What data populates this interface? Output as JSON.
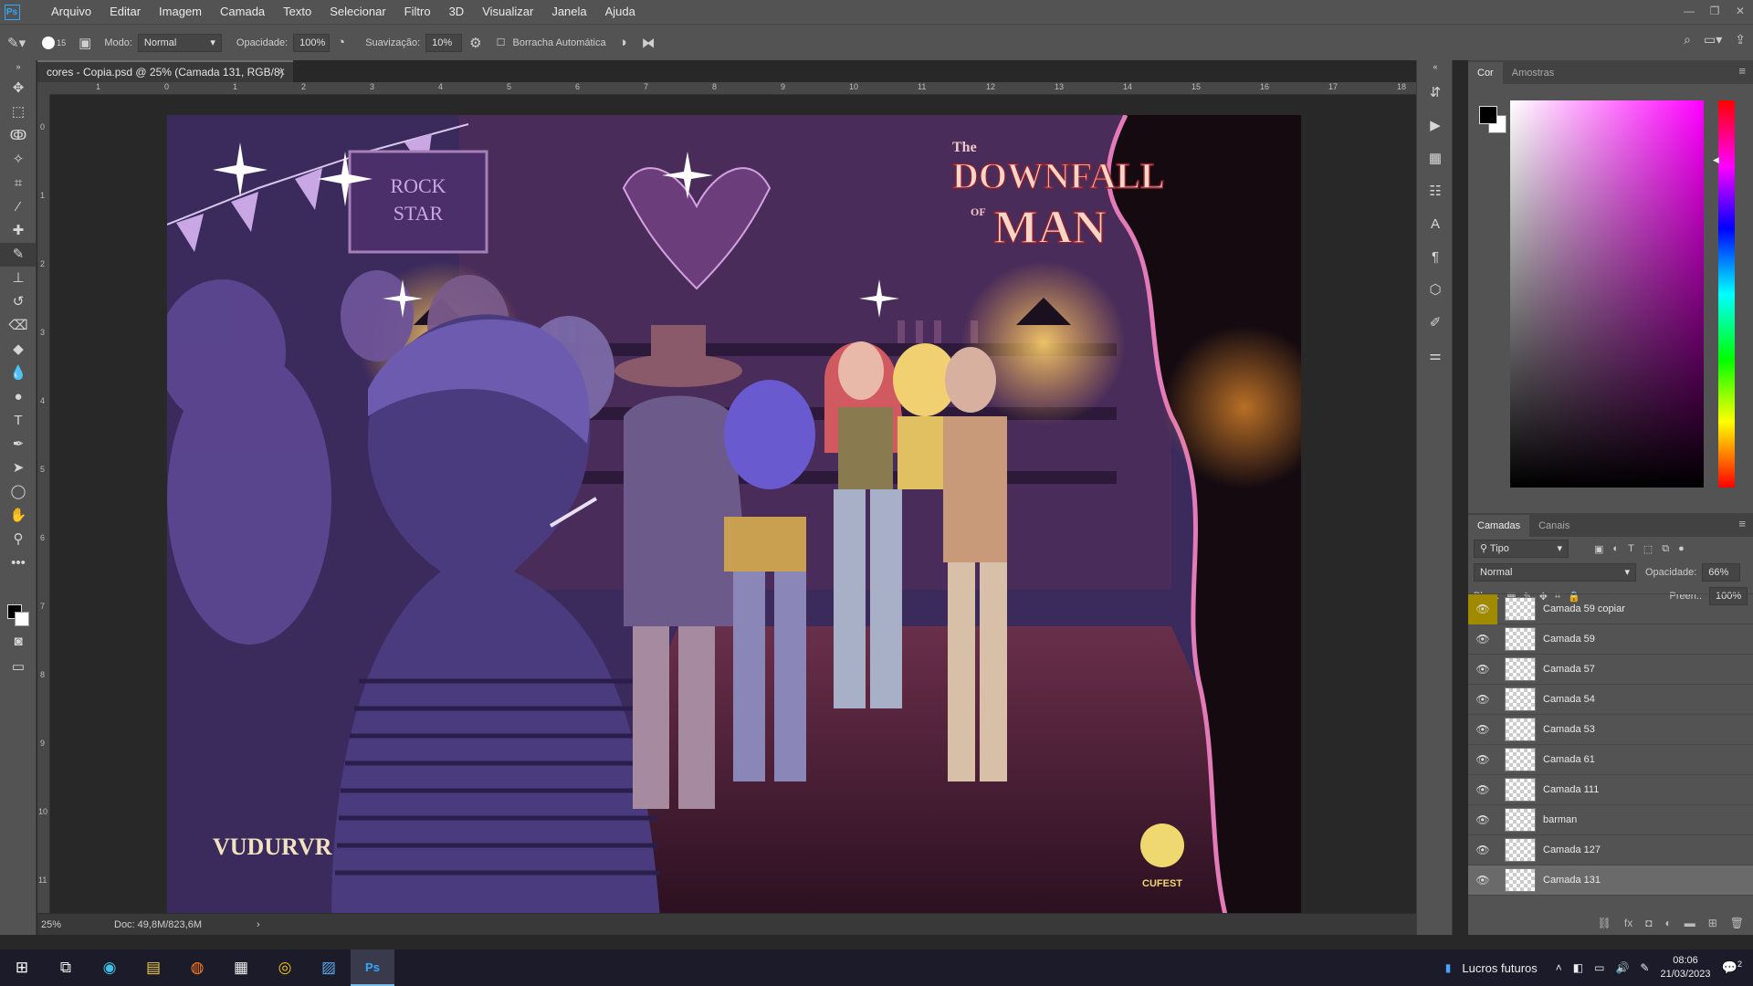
{
  "app": {
    "logo": "Ps"
  },
  "menu": [
    "Arquivo",
    "Editar",
    "Imagem",
    "Camada",
    "Texto",
    "Selecionar",
    "Filtro",
    "3D",
    "Visualizar",
    "Janela",
    "Ajuda"
  ],
  "options": {
    "brush_size": "15",
    "mode_label": "Modo:",
    "mode_value": "Normal",
    "opacity_label": "Opacidade:",
    "opacity_value": "100%",
    "smoothing_label": "Suavização:",
    "smoothing_value": "10%",
    "auto_erase_label": "Borracha Automática"
  },
  "document": {
    "tab_title": "cores - Copia.psd @ 25% (Camada 131, RGB/8)",
    "zoom": "25%",
    "doc_info": "Doc: 49,8M/823,6M",
    "ruler_h": [
      "1",
      "0",
      "1",
      "2",
      "3",
      "4",
      "5",
      "6",
      "7",
      "8",
      "9",
      "10",
      "11",
      "12",
      "13",
      "14",
      "15",
      "16",
      "17",
      "18"
    ],
    "ruler_v": [
      "0",
      "1",
      "2",
      "3",
      "4",
      "5",
      "6",
      "7",
      "8",
      "9",
      "10",
      "11"
    ]
  },
  "artwork": {
    "title_top": "The",
    "title_main": "DOWNFALL",
    "title_of": "OF",
    "title_end": "MAN",
    "signature_left": "VUDURVR",
    "signature_right": "CUFEST",
    "bar_sign_1": "ROCK",
    "bar_sign_2": "STAR"
  },
  "color_panel": {
    "tabs": [
      "Cor",
      "Amostras"
    ]
  },
  "layers_panel": {
    "tabs": [
      "Camadas",
      "Canais"
    ],
    "filter_value": "Tipo",
    "blend_mode": "Normal",
    "opacity_label": "Opacidade:",
    "opacity_value": "66%",
    "lock_label": "Bloq.:",
    "fill_label": "Preen.:",
    "fill_value": "100%",
    "layers": [
      {
        "name": "Camada 59 copiar"
      },
      {
        "name": "Camada 59"
      },
      {
        "name": "Camada 57"
      },
      {
        "name": "Camada 54"
      },
      {
        "name": "Camada 53"
      },
      {
        "name": "Camada 61"
      },
      {
        "name": "Camada 111"
      },
      {
        "name": "barman"
      },
      {
        "name": "Camada 127"
      },
      {
        "name": "Camada 131"
      }
    ]
  },
  "taskbar": {
    "weather": "Lucros futuros",
    "time": "08:06",
    "date": "21/03/2023",
    "notif_count": "2"
  }
}
